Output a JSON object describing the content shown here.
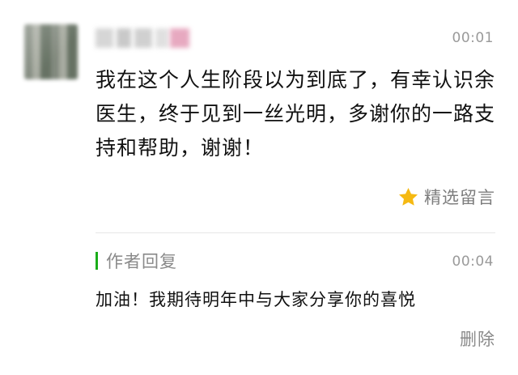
{
  "comment": {
    "avatar_icon": "blurred-user-avatar",
    "username": "",
    "time": "00:01",
    "text": "我在这个人生阶段以为到底了，有幸认识余医生，终于见到一丝光明，多谢你的一路支持和帮助，谢谢！",
    "featured_label": "精选留言",
    "featured_icon": "star-icon",
    "featured_color": "#f5b912"
  },
  "reply": {
    "label": "作者回复",
    "accent_color": "#1aad19",
    "time": "00:04",
    "text": "加油！我期待明年中与大家分享你的喜悦",
    "delete_label": "删除"
  }
}
